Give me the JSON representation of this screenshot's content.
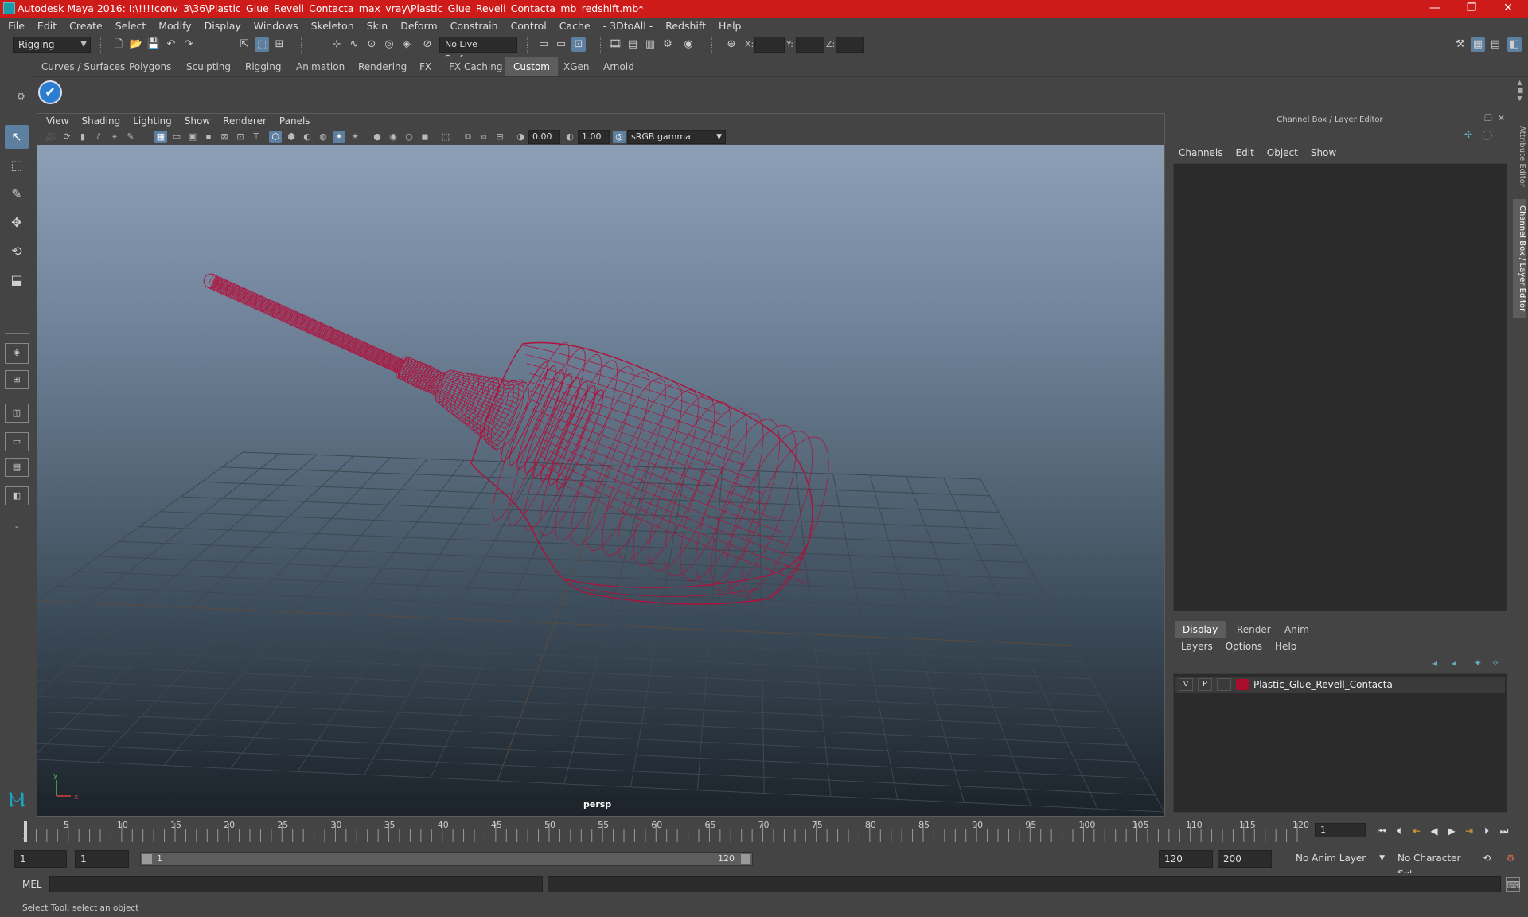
{
  "titlebar": {
    "title": "Autodesk Maya 2016: I:\\!!!!conv_3\\36\\Plastic_Glue_Revell_Contacta_max_vray\\Plastic_Glue_Revell_Contacta_mb_redshift.mb*",
    "minimize": "—",
    "restore": "❐",
    "close": "✕"
  },
  "menubar": {
    "items": [
      "File",
      "Edit",
      "Create",
      "Select",
      "Modify",
      "Display",
      "Windows",
      "Skeleton",
      "Skin",
      "Deform",
      "Constrain",
      "Control",
      "Cache",
      "- 3DtoAll -",
      "Redshift",
      "Help"
    ]
  },
  "statusline": {
    "mode": "Rigging",
    "live_surface": "No Live Surface",
    "x_label": "X:",
    "y_label": "Y:",
    "z_label": "Z:"
  },
  "shelf": {
    "tabs": [
      "Curves / Surfaces",
      "Polygons",
      "Sculpting",
      "Rigging",
      "Animation",
      "Rendering",
      "FX",
      "FX Caching",
      "Custom",
      "XGen",
      "Arnold"
    ],
    "active_tab": "Custom"
  },
  "viewport": {
    "menu": [
      "View",
      "Shading",
      "Lighting",
      "Show",
      "Renderer",
      "Panels"
    ],
    "exposure": "0.00",
    "gamma": "1.00",
    "color_space": "sRGB gamma",
    "camera": "persp",
    "axis_x": "x",
    "axis_y": "y",
    "wire_color": "#b0103a"
  },
  "channelbox": {
    "title": "Channel Box / Layer Editor",
    "menu": [
      "Channels",
      "Edit",
      "Object",
      "Show"
    ]
  },
  "layers": {
    "tabs": [
      "Display",
      "Render",
      "Anim"
    ],
    "active_tab": "Display",
    "menu": [
      "Layers",
      "Options",
      "Help"
    ],
    "rows": [
      {
        "v": "V",
        "p": "P",
        "name": "Plastic_Glue_Revell_Contacta",
        "color": "#aa0d2b"
      }
    ]
  },
  "sidetabs": [
    "Attribute Editor",
    "Channel Box / Layer Editor"
  ],
  "timeslider": {
    "ticks": [
      "5",
      "10",
      "15",
      "20",
      "25",
      "30",
      "35",
      "40",
      "45",
      "50",
      "55",
      "60",
      "65",
      "70",
      "75",
      "80",
      "85",
      "90",
      "95",
      "100",
      "105",
      "110",
      "115",
      "120"
    ],
    "first_tick": "1",
    "current_frame": "1"
  },
  "range": {
    "start": "1",
    "playback_start": "1",
    "bar_start": "1",
    "bar_end": "120",
    "playback_end": "120",
    "end": "200",
    "anim_layer": "No Anim Layer",
    "character_set": "No Character Set"
  },
  "cmdline": {
    "label": "MEL"
  },
  "helpline": {
    "text": "Select Tool: select an object"
  }
}
